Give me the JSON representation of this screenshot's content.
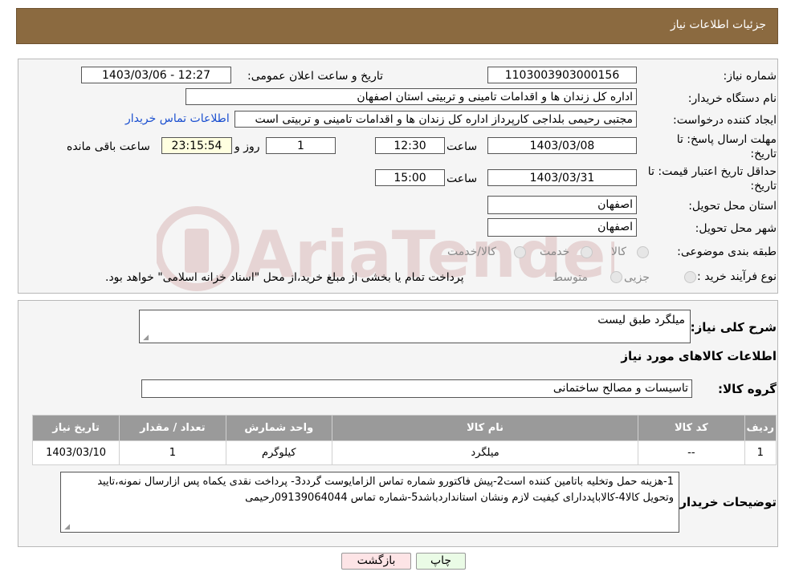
{
  "header": {
    "title": "جزئیات اطلاعات نیاز"
  },
  "form": {
    "need_number_label": "شماره نیاز:",
    "need_number": "1103003903000156",
    "announce_label": "تاریخ و ساعت اعلان عمومی:",
    "announce_value": "1403/03/06 - 12:27",
    "buyer_org_label": "نام دستگاه خریدار:",
    "buyer_org": "اداره کل زندان ها و اقدامات تامینی و تربیتی استان اصفهان",
    "creator_label": "ایجاد کننده درخواست:",
    "creator": "مجتبی رحیمی بلداجی کارپرداز اداره کل زندان ها و اقدامات تامینی و تربیتی است",
    "contact_link": "اطلاعات تماس خریدار",
    "reply_deadline_label_1": "مهلت ارسال پاسخ: تا",
    "reply_deadline_label_2": "تاریخ:",
    "reply_date": "1403/03/08",
    "time_label": "ساعت",
    "reply_time": "12:30",
    "days_value": "1",
    "days_label": "روز و",
    "remaining_time": "23:15:54",
    "remaining_label": "ساعت باقی مانده",
    "price_validity_label_1": "حداقل تاریخ اعتبار قیمت: تا",
    "price_validity_label_2": "تاریخ:",
    "price_date": "1403/03/31",
    "price_time": "15:00",
    "province_label": "استان محل تحویل:",
    "province": "اصفهان",
    "city_label": "شهر محل تحویل:",
    "city": "اصفهان",
    "category_label": "طبقه بندی موضوعی:",
    "category_options": [
      "کالا",
      "خدمت",
      "کالا/خدمت"
    ],
    "process_label": "نوع فرآیند خرید :",
    "process_options": [
      "جزیی",
      "متوسط"
    ],
    "process_note": "پرداخت تمام یا بخشی از مبلغ خرید،از محل \"اسناد خزانه اسلامی\" خواهد بود."
  },
  "details": {
    "summary_label": "شرح کلی نیاز:",
    "summary": "میلگرد طبق لیست",
    "goods_info_title": "اطلاعات کالاهای مورد نیاز",
    "group_label": "گروه کالا:",
    "group": "تاسیسات و مصالح ساختمانی",
    "table": {
      "headers": [
        "ردیف",
        "کد کالا",
        "نام کالا",
        "واحد شمارش",
        "تعداد / مقدار",
        "تاریخ نیاز"
      ],
      "rows": [
        [
          "1",
          "--",
          "میلگرد",
          "کیلوگرم",
          "1",
          "1403/03/10"
        ]
      ]
    },
    "buyer_notes_label": "توضیحات خریدار:",
    "buyer_notes": "1-هزینه حمل وتخلیه باتامین کننده است2-پیش فاکتورو شماره تماس الزامایوست گردد3- پرداخت نقدی یکماه  پس ازارسال نمونه،تایید وتحویل کالا4-کالاباپددارای کیفیت لازم ونشان استانداردباشد5-شماره تماس 09139064044رحیمی"
  },
  "buttons": {
    "print": "چاپ",
    "back": "بازگشت"
  },
  "watermark": {
    "text": "AriaTender.neT",
    "color": "#8b0000"
  }
}
